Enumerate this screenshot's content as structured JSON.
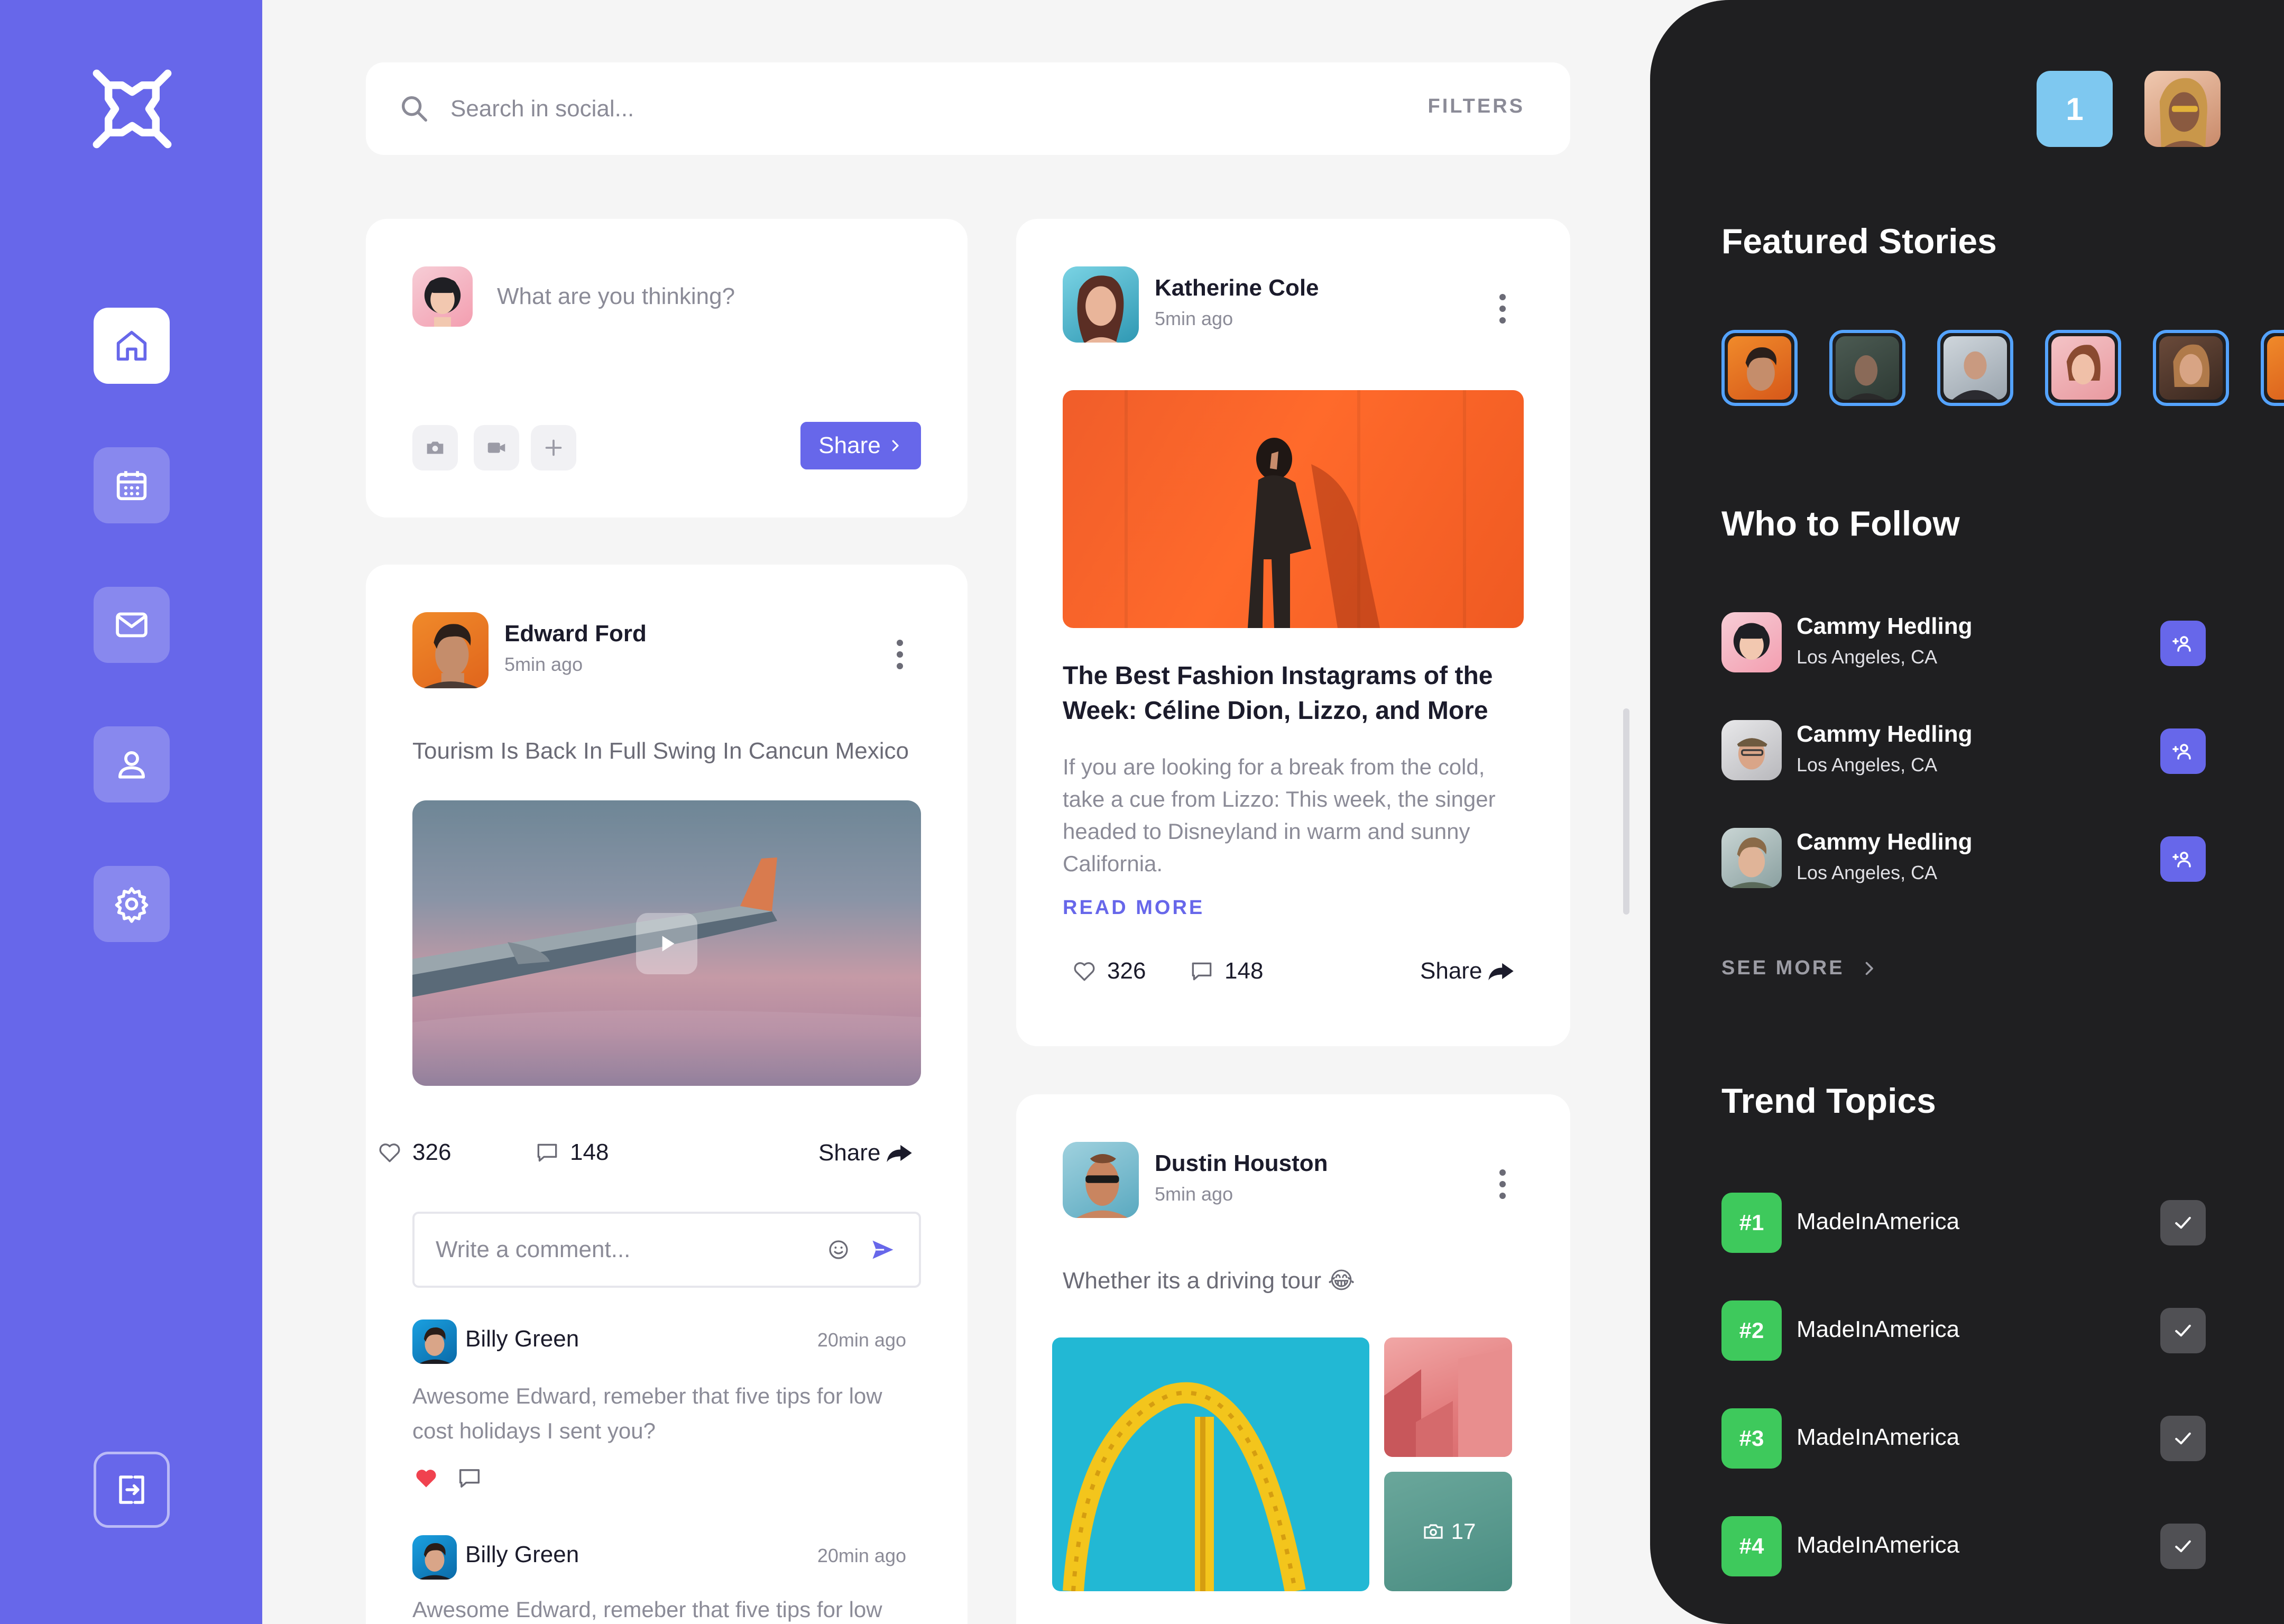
{
  "search": {
    "placeholder": "Search in social...",
    "filters_label": "FILTERS"
  },
  "composer": {
    "placeholder": "What are you thinking?",
    "share_label": "Share"
  },
  "post_edward": {
    "author": "Edward Ford",
    "time": "5min ago",
    "text": "Tourism Is Back In Full Swing In Cancun Mexico",
    "likes": "326",
    "comments": "148",
    "share_label": "Share",
    "comment_placeholder": "Write a comment...",
    "comment_list": [
      {
        "author": "Billy Green",
        "time": "20min ago",
        "text": "Awesome Edward, remeber that five tips for low cost holidays I sent you?"
      },
      {
        "author": "Billy Green",
        "time": "20min ago",
        "text": "Awesome Edward, remeber that five tips for low"
      }
    ]
  },
  "post_katherine": {
    "author": "Katherine Cole",
    "time": "5min ago",
    "title": "The Best Fashion Instagrams of the Week: Céline Dion, Lizzo, and More",
    "body": "If you are looking for a break from the cold, take a cue from Lizzo: This week, the singer headed to Disneyland in warm and sunny California.",
    "read_more": "READ MORE",
    "likes": "326",
    "comments": "148",
    "share_label": "Share"
  },
  "post_dustin": {
    "author": "Dustin Houston",
    "time": "5min ago",
    "text": "Whether its a driving tour 😂",
    "more_photos": "17"
  },
  "right_panel": {
    "notification_count": "1",
    "featured_title": "Featured Stories",
    "follow_title": "Who to Follow",
    "follow": [
      {
        "name": "Cammy Hedling",
        "location": "Los Angeles, CA"
      },
      {
        "name": "Cammy Hedling",
        "location": "Los Angeles, CA"
      },
      {
        "name": "Cammy Hedling",
        "location": "Los Angeles, CA"
      }
    ],
    "see_more": "SEE MORE",
    "trends_title": "Trend Topics",
    "trends": [
      {
        "rank": "#1",
        "name": "MadeInAmerica"
      },
      {
        "rank": "#2",
        "name": "MadeInAmerica"
      },
      {
        "rank": "#3",
        "name": "MadeInAmerica"
      },
      {
        "rank": "#4",
        "name": "MadeInAmerica"
      }
    ]
  },
  "icons": {
    "nav": [
      "home-icon",
      "calendar-icon",
      "mail-icon",
      "user-icon",
      "gear-icon"
    ],
    "logout": "logout-icon"
  },
  "colors": {
    "sidebar": "#6767ea",
    "accent": "#6767ea",
    "right_panel_bg": "#1f1f21",
    "trend_tag": "#3ec95c",
    "story_ring": "#54a3ff",
    "like_red": "#f0424f"
  }
}
